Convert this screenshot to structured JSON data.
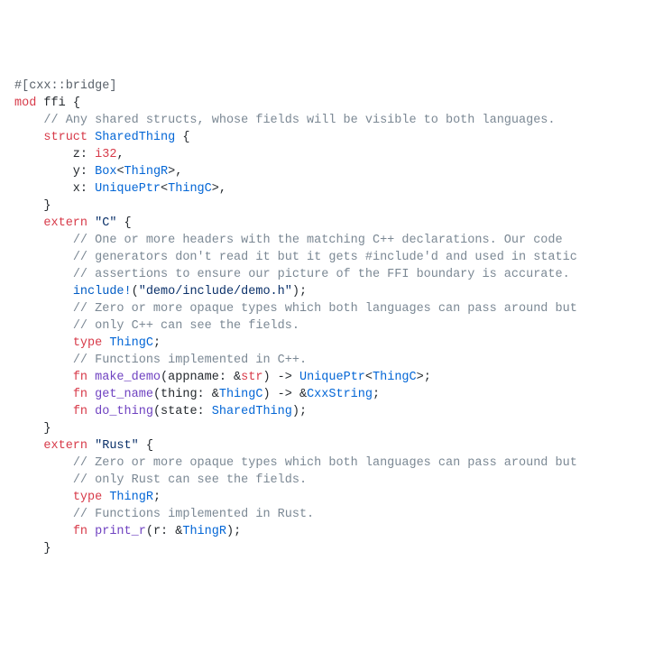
{
  "l01a": "#[cxx::bridge]",
  "l02a": "mod",
  "l02b": " ffi {",
  "l03a": "    ",
  "l03b": "// Any shared structs, whose fields will be visible to both languages.",
  "l04a": "    ",
  "l04b": "struct",
  "l04c": " ",
  "l04d": "SharedThing",
  "l04e": " {",
  "l05a": "        z: ",
  "l05b": "i32",
  "l05c": ",",
  "l06a": "        y: ",
  "l06b": "Box",
  "l06c": "<",
  "l06d": "ThingR",
  "l06e": ">,",
  "l07a": "        x: ",
  "l07b": "UniquePtr",
  "l07c": "<",
  "l07d": "ThingC",
  "l07e": ">,",
  "l08a": "    }",
  "l09a": "",
  "l10a": "    ",
  "l10b": "extern",
  "l10c": " ",
  "l10d": "\"C\"",
  "l10e": " {",
  "l11a": "        ",
  "l11b": "// One or more headers with the matching C++ declarations. Our code",
  "l12a": "        ",
  "l12b": "// generators don't read it but it gets #include'd and used in static",
  "l13a": "        ",
  "l13b": "// assertions to ensure our picture of the FFI boundary is accurate.",
  "l14a": "        ",
  "l14b": "include!",
  "l14c": "(",
  "l14d": "\"demo/include/demo.h\"",
  "l14e": ");",
  "l15a": "",
  "l16a": "        ",
  "l16b": "// Zero or more opaque types which both languages can pass around but",
  "l17a": "        ",
  "l17b": "// only C++ can see the fields.",
  "l18a": "        ",
  "l18b": "type",
  "l18c": " ",
  "l18d": "ThingC",
  "l18e": ";",
  "l19a": "",
  "l20a": "        ",
  "l20b": "// Functions implemented in C++.",
  "l21a": "        ",
  "l21b": "fn",
  "l21c": " ",
  "l21d": "make_demo",
  "l21e": "(appname: &",
  "l21f": "str",
  "l21g": ") -> ",
  "l21h": "UniquePtr",
  "l21i": "<",
  "l21j": "ThingC",
  "l21k": ">;",
  "l22a": "        ",
  "l22b": "fn",
  "l22c": " ",
  "l22d": "get_name",
  "l22e": "(thing: &",
  "l22f": "ThingC",
  "l22g": ") -> &",
  "l22h": "CxxString",
  "l22i": ";",
  "l23a": "        ",
  "l23b": "fn",
  "l23c": " ",
  "l23d": "do_thing",
  "l23e": "(state: ",
  "l23f": "SharedThing",
  "l23g": ");",
  "l24a": "    }",
  "l25a": "",
  "l26a": "    ",
  "l26b": "extern",
  "l26c": " ",
  "l26d": "\"Rust\"",
  "l26e": " {",
  "l27a": "        ",
  "l27b": "// Zero or more opaque types which both languages can pass around but",
  "l28a": "        ",
  "l28b": "// only Rust can see the fields.",
  "l29a": "        ",
  "l29b": "type",
  "l29c": " ",
  "l29d": "ThingR",
  "l29e": ";",
  "l30a": "",
  "l31a": "        ",
  "l31b": "// Functions implemented in Rust.",
  "l32a": "        ",
  "l32b": "fn",
  "l32c": " ",
  "l32d": "print_r",
  "l32e": "(r: &",
  "l32f": "ThingR",
  "l32g": ");",
  "l33a": "    }"
}
